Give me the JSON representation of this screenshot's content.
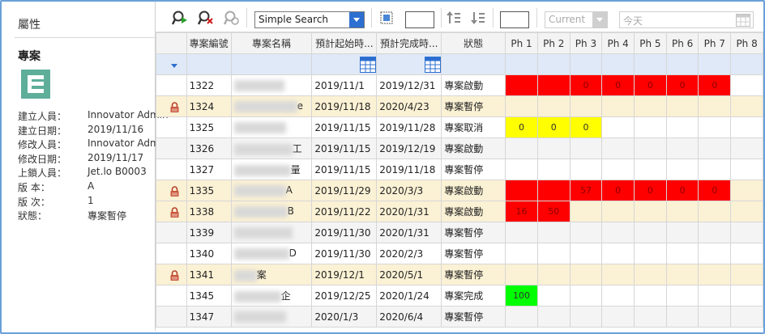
{
  "left_panel": {
    "title": "屬性",
    "item_type": "專案",
    "properties": [
      {
        "key": "建立人員：",
        "value": "Innovator Admin"
      },
      {
        "key": "建立日期：",
        "value": "2019/11/16"
      },
      {
        "key": "修改人員：",
        "value": "Innovator Admin"
      },
      {
        "key": "修改日期：",
        "value": "2019/11/17"
      },
      {
        "key": "上鎖人員：",
        "value": "Jet.lo B0003"
      },
      {
        "key": "版 本：",
        "value": "A"
      },
      {
        "key": "版 次：",
        "value": "1"
      },
      {
        "key": "狀態：",
        "value": "專案暫停"
      }
    ]
  },
  "toolbar": {
    "search_mode": "Simple Search",
    "revision_select": "Current",
    "date_placeholder": "今天"
  },
  "colors": {
    "red": "#ff0000",
    "yellow": "#ffff00",
    "green": "#00ff00",
    "accent": "#2d6fd0"
  },
  "grid": {
    "columns": [
      "",
      "專案編號",
      "專案名稱",
      "預計起始時...",
      "預計完成時...",
      "狀態",
      "Ph 1",
      "Ph 2",
      "Ph 3",
      "Ph 4",
      "Ph 5",
      "Ph 6",
      "Ph 7",
      "Ph 8"
    ],
    "rows": [
      {
        "locked": false,
        "id": "1322",
        "name": "",
        "start": "2019/11/1",
        "end": "2019/12/31",
        "status": "專案啟動",
        "ph": [
          {
            "c": "red",
            "v": ""
          },
          {
            "c": "red",
            "v": ""
          },
          {
            "c": "red",
            "v": "0"
          },
          {
            "c": "red",
            "v": "0"
          },
          {
            "c": "red",
            "v": "0"
          },
          {
            "c": "red",
            "v": "0"
          },
          {
            "c": "red",
            "v": "0"
          },
          {
            "c": "",
            "v": ""
          }
        ]
      },
      {
        "locked": true,
        "id": "1324",
        "name": "e",
        "start": "2019/11/18",
        "end": "2020/4/23",
        "status": "專案暫停",
        "ph": [
          {
            "c": "",
            "v": ""
          },
          {
            "c": "",
            "v": ""
          },
          {
            "c": "",
            "v": ""
          },
          {
            "c": "",
            "v": ""
          },
          {
            "c": "",
            "v": ""
          },
          {
            "c": "",
            "v": ""
          },
          {
            "c": "",
            "v": ""
          },
          {
            "c": "",
            "v": ""
          }
        ]
      },
      {
        "locked": false,
        "id": "1325",
        "name": "",
        "start": "2019/11/15",
        "end": "2019/11/28",
        "status": "專案取消",
        "ph": [
          {
            "c": "yel",
            "v": "0"
          },
          {
            "c": "yel",
            "v": "0"
          },
          {
            "c": "yel",
            "v": "0"
          },
          {
            "c": "",
            "v": ""
          },
          {
            "c": "",
            "v": ""
          },
          {
            "c": "",
            "v": ""
          },
          {
            "c": "",
            "v": ""
          },
          {
            "c": "",
            "v": ""
          }
        ]
      },
      {
        "locked": false,
        "id": "1326",
        "name": "工",
        "start": "2019/11/15",
        "end": "2019/12/19",
        "status": "專案啟動",
        "ph": [
          {
            "c": "",
            "v": ""
          },
          {
            "c": "",
            "v": ""
          },
          {
            "c": "",
            "v": ""
          },
          {
            "c": "",
            "v": ""
          },
          {
            "c": "",
            "v": ""
          },
          {
            "c": "",
            "v": ""
          },
          {
            "c": "",
            "v": ""
          },
          {
            "c": "",
            "v": ""
          }
        ]
      },
      {
        "locked": false,
        "id": "1327",
        "name": "量",
        "start": "2019/11/15",
        "end": "2019/11/18",
        "status": "專案暫停",
        "ph": [
          {
            "c": "",
            "v": ""
          },
          {
            "c": "",
            "v": ""
          },
          {
            "c": "",
            "v": ""
          },
          {
            "c": "",
            "v": ""
          },
          {
            "c": "",
            "v": ""
          },
          {
            "c": "",
            "v": ""
          },
          {
            "c": "",
            "v": ""
          },
          {
            "c": "",
            "v": ""
          }
        ]
      },
      {
        "locked": true,
        "id": "1335",
        "name": "A",
        "start": "2019/11/29",
        "end": "2020/3/3",
        "status": "專案啟動",
        "ph": [
          {
            "c": "red",
            "v": ""
          },
          {
            "c": "red",
            "v": ""
          },
          {
            "c": "red",
            "v": "57"
          },
          {
            "c": "red",
            "v": "0"
          },
          {
            "c": "red",
            "v": "0"
          },
          {
            "c": "red",
            "v": "0"
          },
          {
            "c": "red",
            "v": "0"
          },
          {
            "c": "",
            "v": ""
          }
        ]
      },
      {
        "locked": true,
        "id": "1338",
        "name": "B",
        "start": "2019/11/22",
        "end": "2020/1/31",
        "status": "專案啟動",
        "ph": [
          {
            "c": "red",
            "v": "16"
          },
          {
            "c": "red",
            "v": "50"
          },
          {
            "c": "",
            "v": ""
          },
          {
            "c": "",
            "v": ""
          },
          {
            "c": "",
            "v": ""
          },
          {
            "c": "",
            "v": ""
          },
          {
            "c": "",
            "v": ""
          },
          {
            "c": "",
            "v": ""
          }
        ]
      },
      {
        "locked": false,
        "id": "1339",
        "name": "",
        "start": "2019/11/30",
        "end": "2020/1/31",
        "status": "專案暫停",
        "ph": [
          {
            "c": "",
            "v": ""
          },
          {
            "c": "",
            "v": ""
          },
          {
            "c": "",
            "v": ""
          },
          {
            "c": "",
            "v": ""
          },
          {
            "c": "",
            "v": ""
          },
          {
            "c": "",
            "v": ""
          },
          {
            "c": "",
            "v": ""
          },
          {
            "c": "",
            "v": ""
          }
        ]
      },
      {
        "locked": false,
        "id": "1340",
        "name": "D",
        "start": "2019/11/30",
        "end": "2020/2/3",
        "status": "專案暫停",
        "ph": [
          {
            "c": "",
            "v": ""
          },
          {
            "c": "",
            "v": ""
          },
          {
            "c": "",
            "v": ""
          },
          {
            "c": "",
            "v": ""
          },
          {
            "c": "",
            "v": ""
          },
          {
            "c": "",
            "v": ""
          },
          {
            "c": "",
            "v": ""
          },
          {
            "c": "",
            "v": ""
          }
        ]
      },
      {
        "locked": true,
        "id": "1341",
        "name": "案",
        "start": "2019/12/1",
        "end": "2020/5/1",
        "status": "專案暫停",
        "ph": [
          {
            "c": "",
            "v": ""
          },
          {
            "c": "",
            "v": ""
          },
          {
            "c": "",
            "v": ""
          },
          {
            "c": "",
            "v": ""
          },
          {
            "c": "",
            "v": ""
          },
          {
            "c": "",
            "v": ""
          },
          {
            "c": "",
            "v": ""
          },
          {
            "c": "",
            "v": ""
          }
        ]
      },
      {
        "locked": false,
        "id": "1345",
        "name": "企",
        "start": "2019/12/25",
        "end": "2020/1/24",
        "status": "專案完成",
        "ph": [
          {
            "c": "grn",
            "v": "100"
          },
          {
            "c": "",
            "v": ""
          },
          {
            "c": "",
            "v": ""
          },
          {
            "c": "",
            "v": ""
          },
          {
            "c": "",
            "v": ""
          },
          {
            "c": "",
            "v": ""
          },
          {
            "c": "",
            "v": ""
          },
          {
            "c": "",
            "v": ""
          }
        ]
      },
      {
        "locked": false,
        "id": "1347",
        "name": "",
        "start": "2020/1/3",
        "end": "2020/6/4",
        "status": "專案暫停",
        "ph": [
          {
            "c": "",
            "v": ""
          },
          {
            "c": "",
            "v": ""
          },
          {
            "c": "",
            "v": ""
          },
          {
            "c": "",
            "v": ""
          },
          {
            "c": "",
            "v": ""
          },
          {
            "c": "",
            "v": ""
          },
          {
            "c": "",
            "v": ""
          },
          {
            "c": "",
            "v": ""
          }
        ]
      }
    ]
  }
}
